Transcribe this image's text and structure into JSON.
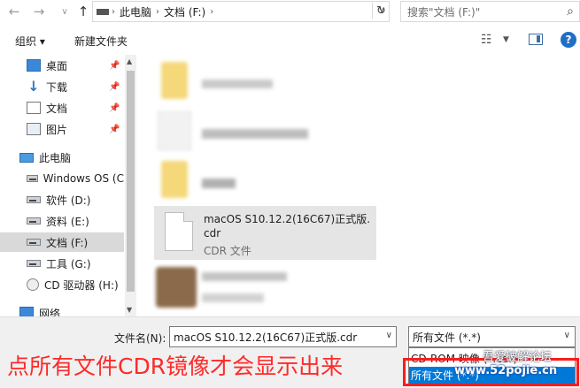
{
  "address_bar": {
    "breadcrumb": [
      "此电脑",
      "文档 (F:)"
    ],
    "search_placeholder": "搜索\"文档 (F:)\""
  },
  "toolbar": {
    "organize": "组织 ▾",
    "new_folder": "新建文件夹"
  },
  "sidebar": {
    "items": [
      {
        "label": "桌面",
        "icon": "desktop-icon"
      },
      {
        "label": "下载",
        "icon": "download-icon"
      },
      {
        "label": "文档",
        "icon": "document-icon"
      },
      {
        "label": "图片",
        "icon": "pictures-icon"
      },
      {
        "label": "此电脑",
        "icon": "computer-icon"
      },
      {
        "label": "Windows OS (C",
        "icon": "drive-icon"
      },
      {
        "label": "软件 (D:)",
        "icon": "drive-icon"
      },
      {
        "label": "资料 (E:)",
        "icon": "drive-icon"
      },
      {
        "label": "文档 (F:)",
        "icon": "drive-icon",
        "selected": true
      },
      {
        "label": "工具 (G:)",
        "icon": "drive-icon"
      },
      {
        "label": "CD 驱动器 (H:)",
        "icon": "cd-drive-icon"
      },
      {
        "label": "网络",
        "icon": "network-icon"
      }
    ]
  },
  "file_view": {
    "selected_file": {
      "name_line1": "macOS S10.12.2(16C67)正式版.",
      "name_line2": "cdr",
      "type": "CDR 文件"
    }
  },
  "footer": {
    "filename_label": "文件名(N):",
    "filename_value": "macOS S10.12.2(16C67)正式版.cdr",
    "filetype_value": "所有文件 (*.*)",
    "filetype_options": [
      "CD-ROM 映像 (*.cdr)",
      "所有文件 (*.*)"
    ],
    "hint_text": "点所有文件CDR镜像才会显示出来",
    "watermark_url": "www.52pojie.cn",
    "watermark_text": "吾爱破解论坛"
  },
  "colors": {
    "accent": "#0078d7",
    "hint": "#ff2a2a",
    "selected_nav": "#d9d9d9"
  }
}
